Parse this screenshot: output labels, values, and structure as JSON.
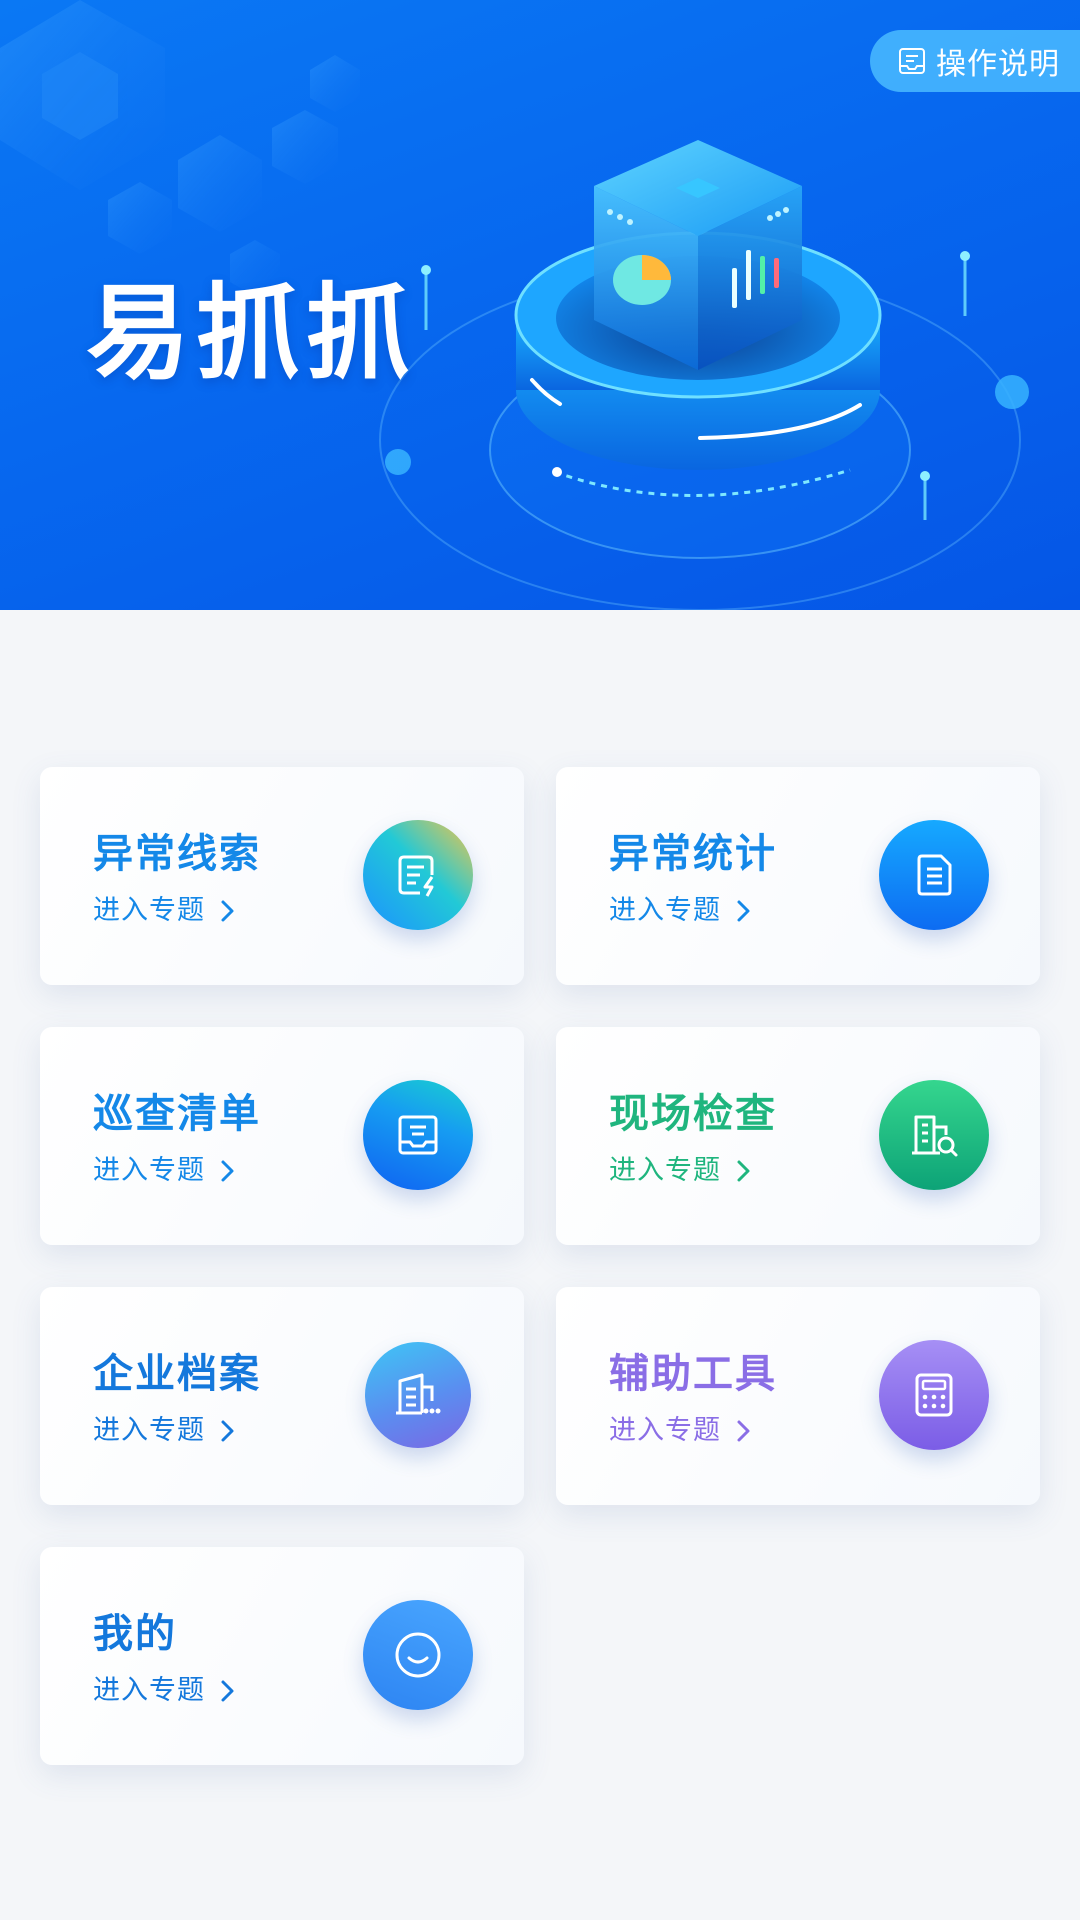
{
  "header": {
    "title": "易抓抓",
    "help_label": "操作说明"
  },
  "colors": {
    "hero_blue": "#0768ef",
    "accent_blue": "#1488e8",
    "accent_green": "#1fb57e",
    "accent_purple": "#8a6ee6"
  },
  "modules": [
    {
      "title": "异常线索",
      "link": "进入专题",
      "icon": "document-lightning-icon"
    },
    {
      "title": "异常统计",
      "link": "进入专题",
      "icon": "document-list-icon"
    },
    {
      "title": "巡查清单",
      "link": "进入专题",
      "icon": "inbox-tray-icon"
    },
    {
      "title": "现场检查",
      "link": "进入专题",
      "icon": "building-search-icon"
    },
    {
      "title": "企业档案",
      "link": "进入专题",
      "icon": "company-file-icon"
    },
    {
      "title": "辅助工具",
      "link": "进入专题",
      "icon": "calculator-icon"
    },
    {
      "title": "我的",
      "link": "进入专题",
      "icon": "smile-icon"
    }
  ]
}
